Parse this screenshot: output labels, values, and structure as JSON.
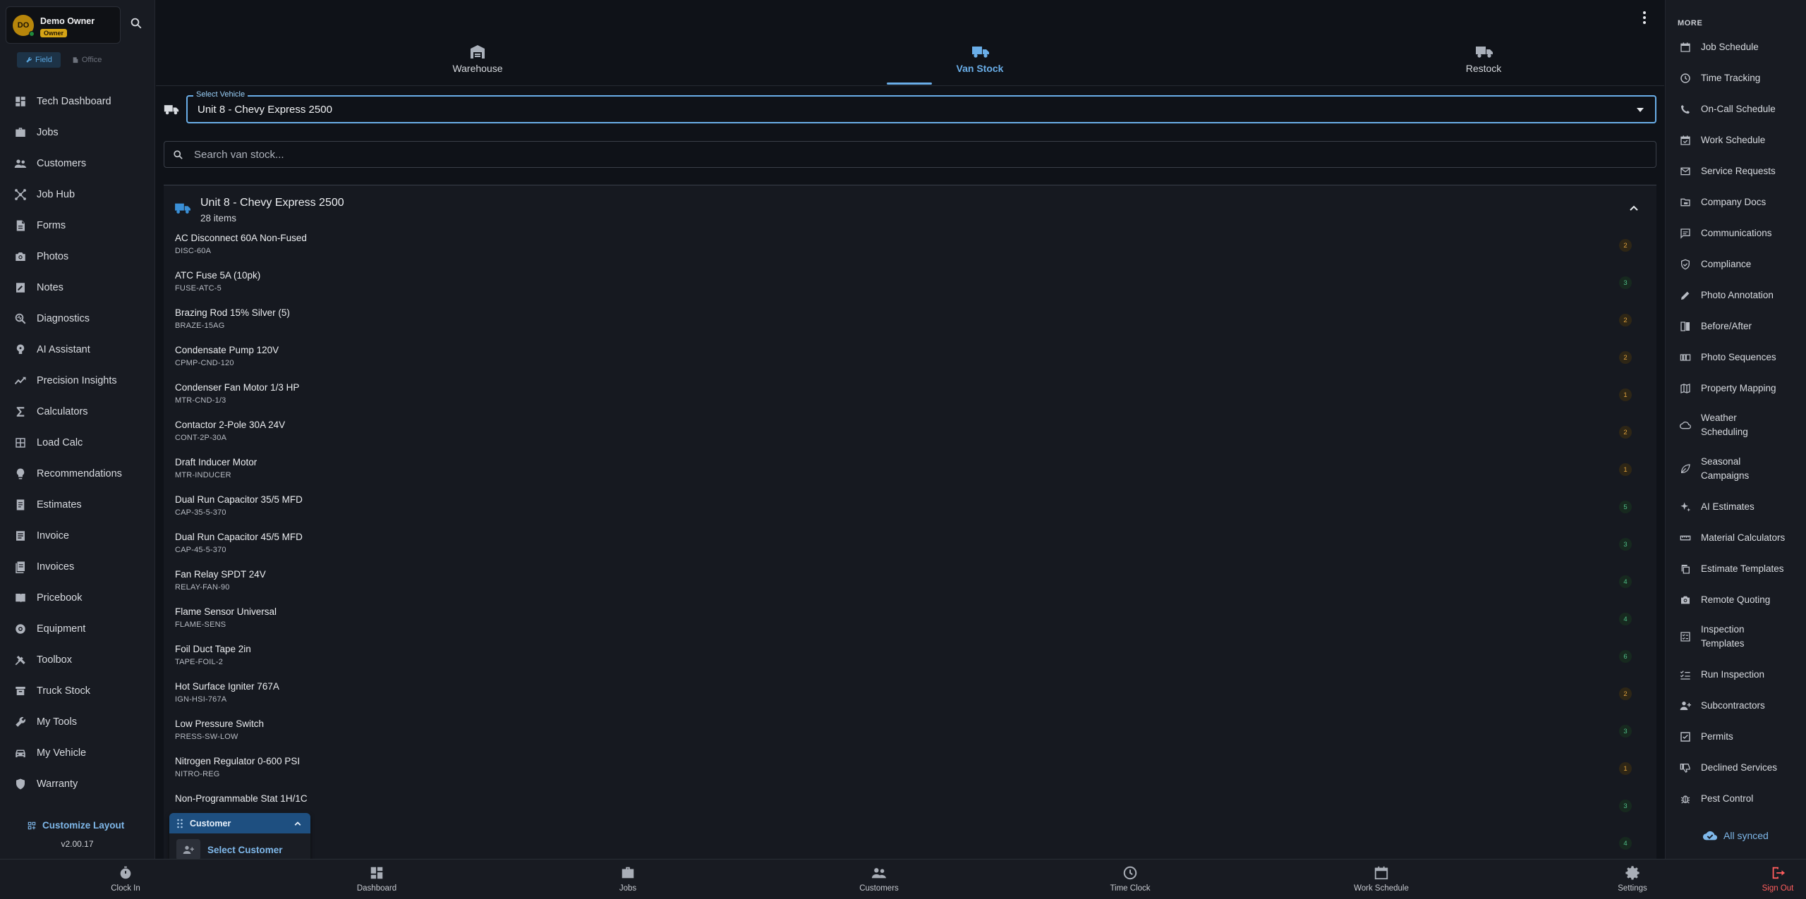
{
  "profile": {
    "initials": "DO",
    "name": "Demo Owner",
    "role_badge": "Owner"
  },
  "mode_toggle": {
    "field": "Field",
    "office": "Office"
  },
  "sidebar": {
    "items": [
      {
        "label": "Tech Dashboard",
        "icon": "dashboard-icon"
      },
      {
        "label": "Jobs",
        "icon": "briefcase-icon"
      },
      {
        "label": "Customers",
        "icon": "people-icon"
      },
      {
        "label": "Job Hub",
        "icon": "hub-icon"
      },
      {
        "label": "Forms",
        "icon": "form-icon"
      },
      {
        "label": "Photos",
        "icon": "camera-icon"
      },
      {
        "label": "Notes",
        "icon": "note-icon"
      },
      {
        "label": "Diagnostics",
        "icon": "diagnostics-icon"
      },
      {
        "label": "AI Assistant",
        "icon": "ai-assistant-icon"
      },
      {
        "label": "Precision Insights",
        "icon": "trend-icon"
      },
      {
        "label": "Calculators",
        "icon": "sigma-icon"
      },
      {
        "label": "Load Calc",
        "icon": "grid-calc-icon"
      },
      {
        "label": "Recommendations",
        "icon": "lightbulb-icon"
      },
      {
        "label": "Estimates",
        "icon": "estimate-icon"
      },
      {
        "label": "Invoice",
        "icon": "invoice-icon"
      },
      {
        "label": "Invoices",
        "icon": "invoices-icon"
      },
      {
        "label": "Pricebook",
        "icon": "book-icon"
      },
      {
        "label": "Equipment",
        "icon": "equipment-icon"
      },
      {
        "label": "Toolbox",
        "icon": "toolbox-icon"
      },
      {
        "label": "Truck Stock",
        "icon": "truck-stock-icon"
      },
      {
        "label": "My Tools",
        "icon": "wrench-icon"
      },
      {
        "label": "My Vehicle",
        "icon": "car-icon"
      },
      {
        "label": "Warranty",
        "icon": "shield-icon"
      }
    ],
    "customize_label": "Customize Layout",
    "version": "v2.00.17"
  },
  "top_tabs": [
    {
      "label": "Warehouse",
      "icon": "warehouse-icon",
      "active": false
    },
    {
      "label": "Van Stock",
      "icon": "truck-icon",
      "active": true
    },
    {
      "label": "Restock",
      "icon": "truck-icon",
      "active": false
    }
  ],
  "vehicle_select": {
    "legend": "Select Vehicle",
    "value": "Unit 8 - Chevy Express 2500"
  },
  "search": {
    "placeholder": "Search van stock..."
  },
  "group": {
    "title": "Unit 8 - Chevy Express 2500",
    "count": "28 items",
    "items": [
      {
        "name": "AC Disconnect 60A Non-Fused",
        "sku": "DISC-60A",
        "qty": "2",
        "status": "warn"
      },
      {
        "name": "ATC Fuse 5A (10pk)",
        "sku": "FUSE-ATC-5",
        "qty": "3",
        "status": "ok"
      },
      {
        "name": "Brazing Rod 15% Silver (5)",
        "sku": "BRAZE-15AG",
        "qty": "2",
        "status": "warn"
      },
      {
        "name": "Condensate Pump 120V",
        "sku": "CPMP-CND-120",
        "qty": "2",
        "status": "warn"
      },
      {
        "name": "Condenser Fan Motor 1/3 HP",
        "sku": "MTR-CND-1/3",
        "qty": "1",
        "status": "warn"
      },
      {
        "name": "Contactor 2-Pole 30A 24V",
        "sku": "CONT-2P-30A",
        "qty": "2",
        "status": "warn"
      },
      {
        "name": "Draft Inducer Motor",
        "sku": "MTR-INDUCER",
        "qty": "1",
        "status": "warn"
      },
      {
        "name": "Dual Run Capacitor 35/5 MFD",
        "sku": "CAP-35-5-370",
        "qty": "5",
        "status": "ok"
      },
      {
        "name": "Dual Run Capacitor 45/5 MFD",
        "sku": "CAP-45-5-370",
        "qty": "3",
        "status": "ok"
      },
      {
        "name": "Fan Relay SPDT 24V",
        "sku": "RELAY-FAN-90",
        "qty": "4",
        "status": "ok"
      },
      {
        "name": "Flame Sensor Universal",
        "sku": "FLAME-SENS",
        "qty": "4",
        "status": "ok"
      },
      {
        "name": "Foil Duct Tape 2in",
        "sku": "TAPE-FOIL-2",
        "qty": "6",
        "status": "ok"
      },
      {
        "name": "Hot Surface Igniter 767A",
        "sku": "IGN-HSI-767A",
        "qty": "2",
        "status": "warn"
      },
      {
        "name": "Low Pressure Switch",
        "sku": "PRESS-SW-LOW",
        "qty": "3",
        "status": "ok"
      },
      {
        "name": "Nitrogen Regulator 0-600 PSI",
        "sku": "NITRO-REG",
        "qty": "1",
        "status": "warn"
      },
      {
        "name": "Non-Programmable Stat 1H/1C",
        "sku": "",
        "qty": "3",
        "status": "ok"
      },
      {
        "name": "",
        "sku": "",
        "qty": "4",
        "status": "ok"
      }
    ]
  },
  "customer_widget": {
    "title": "Customer",
    "select_label": "Select Customer"
  },
  "more": {
    "title": "MORE",
    "items": [
      {
        "label": "Job Schedule",
        "icon": "calendar-icon"
      },
      {
        "label": "Time Tracking",
        "icon": "clock-icon"
      },
      {
        "label": "On-Call Schedule",
        "icon": "phone-icon"
      },
      {
        "label": "Work Schedule",
        "icon": "calendar-check-icon"
      },
      {
        "label": "Service Requests",
        "icon": "mail-icon"
      },
      {
        "label": "Company Docs",
        "icon": "folder-icon"
      },
      {
        "label": "Communications",
        "icon": "chat-icon"
      },
      {
        "label": "Compliance",
        "icon": "shield-check-icon"
      },
      {
        "label": "Photo Annotation",
        "icon": "pencil-icon"
      },
      {
        "label": "Before/After",
        "icon": "compare-icon"
      },
      {
        "label": "Photo Sequences",
        "icon": "sequence-icon"
      },
      {
        "label": "Property Mapping",
        "icon": "map-icon"
      },
      {
        "label": "Weather Scheduling",
        "icon": "cloud-icon"
      },
      {
        "label": "Seasonal Campaigns",
        "icon": "leaf-icon"
      },
      {
        "label": "AI Estimates",
        "icon": "sparkle-icon"
      },
      {
        "label": "Material Calculators",
        "icon": "ruler-icon"
      },
      {
        "label": "Estimate Templates",
        "icon": "copy-icon"
      },
      {
        "label": "Remote Quoting",
        "icon": "camera-icon"
      },
      {
        "label": "Inspection Templates",
        "icon": "checklist-icon"
      },
      {
        "label": "Run Inspection",
        "icon": "list-check-icon"
      },
      {
        "label": "Subcontractors",
        "icon": "people-add-icon"
      },
      {
        "label": "Permits",
        "icon": "checkbox-icon"
      },
      {
        "label": "Declined Services",
        "icon": "thumb-down-icon"
      },
      {
        "label": "Pest Control",
        "icon": "bug-icon"
      }
    ],
    "sync_status": "All synced"
  },
  "bottom_nav": [
    {
      "label": "Clock In",
      "icon": "stopwatch-icon"
    },
    {
      "label": "Dashboard",
      "icon": "dashboard-icon"
    },
    {
      "label": "Jobs",
      "icon": "briefcase-icon"
    },
    {
      "label": "Customers",
      "icon": "people-icon"
    },
    {
      "label": "Time Clock",
      "icon": "clock-icon"
    },
    {
      "label": "Work Schedule",
      "icon": "calendar-icon"
    },
    {
      "label": "Settings",
      "icon": "gear-icon"
    },
    {
      "label": "Sign Out",
      "icon": "sign-out-icon"
    }
  ],
  "colors": {
    "accent": "#6aaee8",
    "warn": "#e0a23c",
    "ok": "#4fbf88",
    "owner_badge": "#d6a516",
    "sign_out": "#ff5d5d"
  }
}
